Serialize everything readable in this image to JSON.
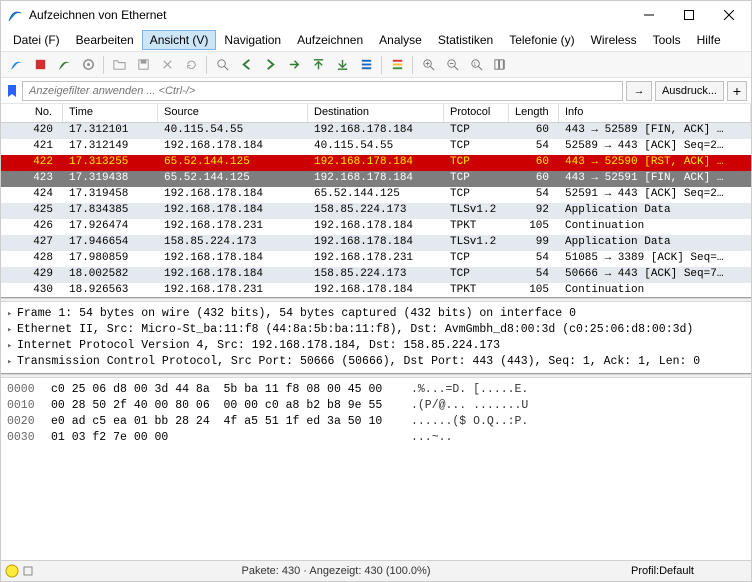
{
  "window": {
    "title": "Aufzeichnen von Ethernet"
  },
  "menu": {
    "file": "Datei (F)",
    "edit": "Bearbeiten",
    "view": "Ansicht (V)",
    "nav": "Navigation",
    "capture": "Aufzeichnen",
    "analyze": "Analyse",
    "stats": "Statistiken",
    "tel": "Telefonie (y)",
    "wireless": "Wireless",
    "tools": "Tools",
    "help": "Hilfe"
  },
  "filter": {
    "placeholder": "Anzeigefilter anwenden ... <Ctrl-/>",
    "apply": "Ausdruck...",
    "arrow": "→"
  },
  "columns": {
    "no": "No.",
    "time": "Time",
    "src": "Source",
    "dst": "Destination",
    "proto": "Protocol",
    "len": "Length",
    "info": "Info"
  },
  "packets": [
    {
      "no": "420",
      "time": "17.312101",
      "src": "40.115.54.55",
      "dst": "192.168.178.184",
      "proto": "TCP",
      "len": "60",
      "info": "443 → 52589 [FIN, ACK] …",
      "style": "zebra1"
    },
    {
      "no": "421",
      "time": "17.312149",
      "src": "192.168.178.184",
      "dst": "40.115.54.55",
      "proto": "TCP",
      "len": "54",
      "info": "52589 → 443 [ACK] Seq=2…",
      "style": "zebra0"
    },
    {
      "no": "422",
      "time": "17.313255",
      "src": "65.52.144.125",
      "dst": "192.168.178.184",
      "proto": "TCP",
      "len": "60",
      "info": "443 → 52590 [RST, ACK] …",
      "style": "red"
    },
    {
      "no": "423",
      "time": "17.319438",
      "src": "65.52.144.125",
      "dst": "192.168.178.184",
      "proto": "TCP",
      "len": "60",
      "info": "443 → 52591 [FIN, ACK] …",
      "style": "gray"
    },
    {
      "no": "424",
      "time": "17.319458",
      "src": "192.168.178.184",
      "dst": "65.52.144.125",
      "proto": "TCP",
      "len": "54",
      "info": "52591 → 443 [ACK] Seq=2…",
      "style": "zebra0"
    },
    {
      "no": "425",
      "time": "17.834385",
      "src": "192.168.178.184",
      "dst": "158.85.224.173",
      "proto": "TLSv1.2",
      "len": "92",
      "info": "Application Data",
      "style": "zebra1"
    },
    {
      "no": "426",
      "time": "17.926474",
      "src": "192.168.178.231",
      "dst": "192.168.178.184",
      "proto": "TPKT",
      "len": "105",
      "info": "Continuation",
      "style": "zebra0"
    },
    {
      "no": "427",
      "time": "17.946654",
      "src": "158.85.224.173",
      "dst": "192.168.178.184",
      "proto": "TLSv1.2",
      "len": "99",
      "info": "Application Data",
      "style": "zebra1"
    },
    {
      "no": "428",
      "time": "17.980859",
      "src": "192.168.178.184",
      "dst": "192.168.178.231",
      "proto": "TCP",
      "len": "54",
      "info": "51085 → 3389 [ACK] Seq=…",
      "style": "zebra0"
    },
    {
      "no": "429",
      "time": "18.002582",
      "src": "192.168.178.184",
      "dst": "158.85.224.173",
      "proto": "TCP",
      "len": "54",
      "info": "50666 → 443 [ACK] Seq=7…",
      "style": "zebra1"
    },
    {
      "no": "430",
      "time": "18.926563",
      "src": "192.168.178.231",
      "dst": "192.168.178.184",
      "proto": "TPKT",
      "len": "105",
      "info": "Continuation",
      "style": "zebra0"
    }
  ],
  "details": [
    "Frame 1: 54 bytes on wire (432 bits), 54 bytes captured (432 bits) on interface 0",
    "Ethernet II, Src: Micro-St_ba:11:f8 (44:8a:5b:ba:11:f8), Dst: AvmGmbh_d8:00:3d (c0:25:06:d8:00:3d)",
    "Internet Protocol Version 4, Src: 192.168.178.184, Dst: 158.85.224.173",
    "Transmission Control Protocol, Src Port: 50666 (50666), Dst Port: 443 (443), Seq: 1, Ack: 1, Len: 0"
  ],
  "hex": [
    {
      "ofs": "0000",
      "b": "c0 25 06 d8 00 3d 44 8a  5b ba 11 f8 08 00 45 00",
      "a": ".%...=D. [.....E."
    },
    {
      "ofs": "0010",
      "b": "00 28 50 2f 40 00 80 06  00 00 c0 a8 b2 b8 9e 55",
      "a": ".(P/@... .......U"
    },
    {
      "ofs": "0020",
      "b": "e0 ad c5 ea 01 bb 28 24  4f a5 51 1f ed 3a 50 10",
      "a": "......($ O.Q..:P."
    },
    {
      "ofs": "0030",
      "b": "01 03 f2 7e 00 00",
      "a": "...~.."
    }
  ],
  "status": {
    "packets": "Pakete: 430 · Angezeigt: 430 (100.0%)",
    "profile": "Profil:Default"
  }
}
